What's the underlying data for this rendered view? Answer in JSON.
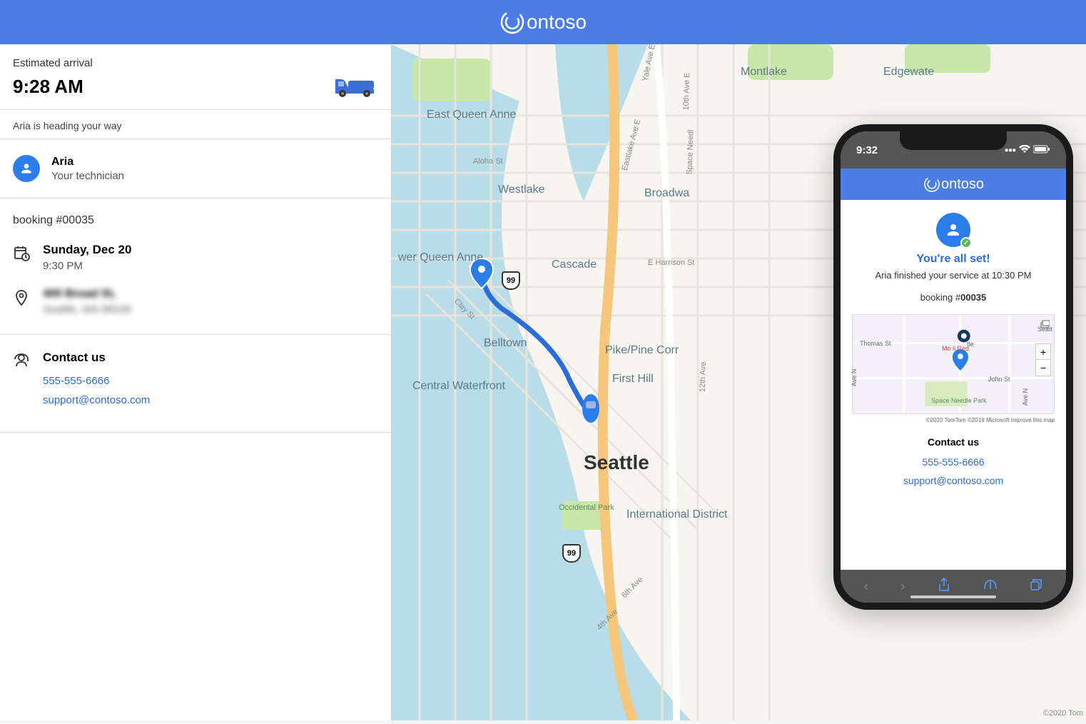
{
  "brand": "ontoso",
  "sidebar": {
    "eta_label": "Estimated arrival",
    "eta_time": "9:28 AM",
    "status": "Aria is heading your way",
    "technician": {
      "name": "Aria",
      "role": "Your technician"
    },
    "booking_label": "booking #00035",
    "schedule": {
      "date": "Sunday, Dec 20",
      "time": "9:30 PM"
    },
    "address": {
      "line1": "400 Broad St,",
      "line2": "Seattle, WA 98109"
    },
    "contact": {
      "title": "Contact us",
      "phone": "555-555-6666",
      "email": "support@contoso.com"
    }
  },
  "map": {
    "city": "Seattle",
    "neighborhoods": [
      "East Queen Anne",
      "wer Queen Anne",
      "Westlake",
      "Cascade",
      "Belltown",
      "Central Waterfront",
      "First Hill",
      "International District",
      "Pike/Pine Corr",
      "Broadwa",
      "Montlake",
      "Edgewate"
    ],
    "streets": [
      "Aloha St",
      "Yale Ave E",
      "Eastlake Ave E",
      "10th Ave E",
      "12th Ave",
      "6th Ave",
      "4th Ave",
      "E Harrison St",
      "Clay St",
      "Space Needl"
    ],
    "parks": [
      "Occidental Park"
    ],
    "highway": "99",
    "attribution": "©2020 Tom"
  },
  "phone": {
    "time": "9:32",
    "title": "You're all set!",
    "description": "Aria finished your service at 10:30 PM",
    "booking_prefix": "booking #",
    "booking_number": "00035",
    "contact_title": "Contact us",
    "phone": "555-555-6666",
    "email": "support@contoso.com",
    "minimap": {
      "streets": [
        "Thomas St",
        "John St",
        "Space Needle Park",
        "Ave N",
        "Seatt",
        "Mo    il Red",
        "tle"
      ],
      "attribution": "©2020 TomTom ©2019 Microsoft  Improve this map"
    }
  }
}
